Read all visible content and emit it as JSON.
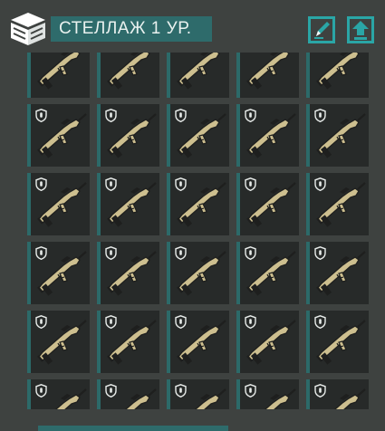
{
  "header": {
    "icon": "storage-box-icon",
    "title": "СТЕЛЛАЖ 1 УР.",
    "edit_icon": "edit-pencil-icon",
    "upload_icon": "upload-arrow-icon"
  },
  "grid": {
    "columns": 5,
    "visible_rows": 6,
    "item_icon": "bullpup-rifle-icon",
    "badge_icon": "shield-icon",
    "colors": {
      "slot_bg": "#272a29",
      "slot_accent": "#2c6a69",
      "weapon_body": "#cdbf8f",
      "weapon_dark": "#1e1f1e"
    }
  },
  "colors": {
    "background": "#3e4240",
    "accent": "#2e6b6b",
    "icon_accent": "#2aa6a6"
  }
}
